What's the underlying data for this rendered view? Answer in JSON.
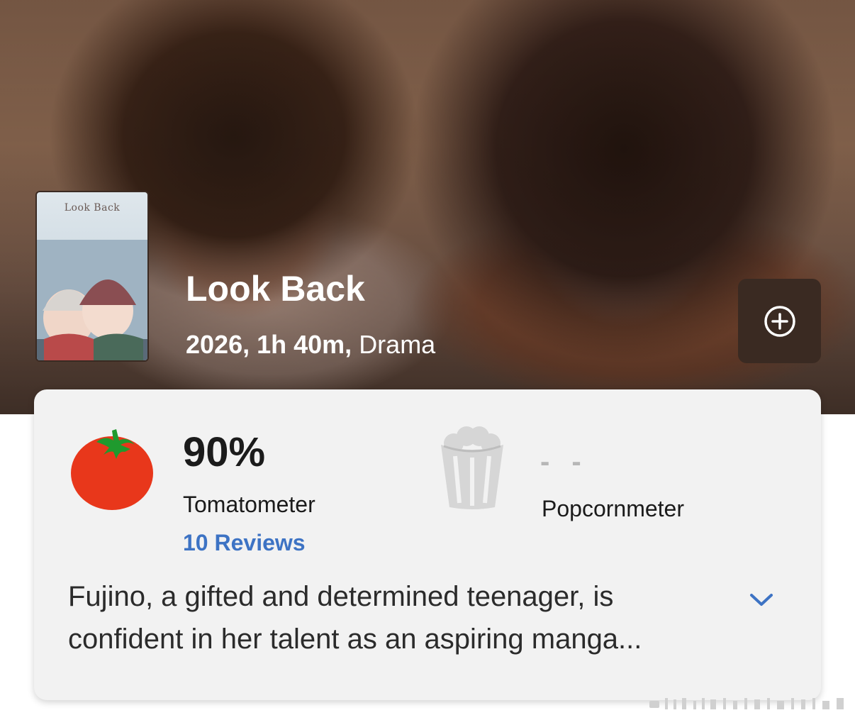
{
  "movie": {
    "poster_text": "Look Back",
    "title": "Look Back",
    "meta_bold": "2026, 1h 40m,",
    "meta_genre": "Drama",
    "add_icon": "plus-circle-icon"
  },
  "scores": {
    "tomatometer": {
      "value": "90%",
      "label": "Tomatometer",
      "reviews": "10 Reviews",
      "icon": "tomato-icon"
    },
    "popcornmeter": {
      "value": "- -",
      "label": "Popcornmeter",
      "icon": "popcorn-bucket-icon"
    }
  },
  "synopsis": {
    "text": "Fujino, a gifted and determined teenager, is confident in her talent as an aspiring manga...",
    "expand_icon": "chevron-down-icon"
  },
  "colors": {
    "link": "#3d73c4",
    "tomato": "#e8371b",
    "card_bg": "#f2f2f2"
  }
}
